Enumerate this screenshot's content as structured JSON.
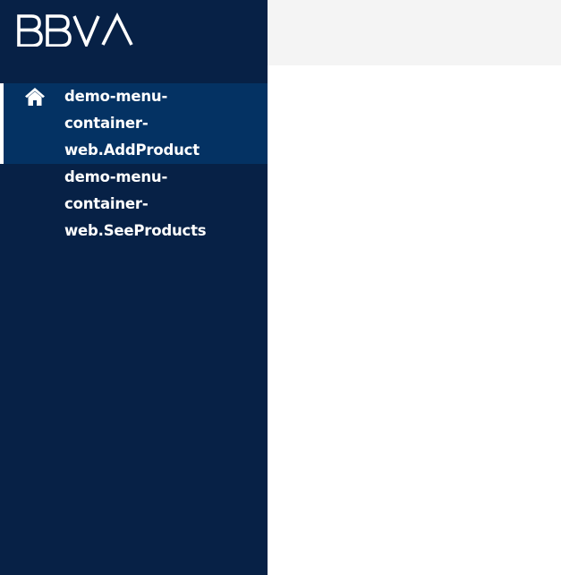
{
  "brand": {
    "logo_text": "BBVA",
    "logo_color": "#ffffff"
  },
  "colors": {
    "sidebar_bg": "#072146",
    "active_item_bg": "#043263",
    "topbar_bg": "#f4f4f4",
    "content_bg": "#ffffff"
  },
  "sidebar": {
    "items": [
      {
        "label": "demo-menu-container-web.AddProduct",
        "icon": "home-icon",
        "active": true
      },
      {
        "label": "demo-menu-container-web.SeeProducts",
        "icon": "",
        "active": false
      }
    ]
  }
}
